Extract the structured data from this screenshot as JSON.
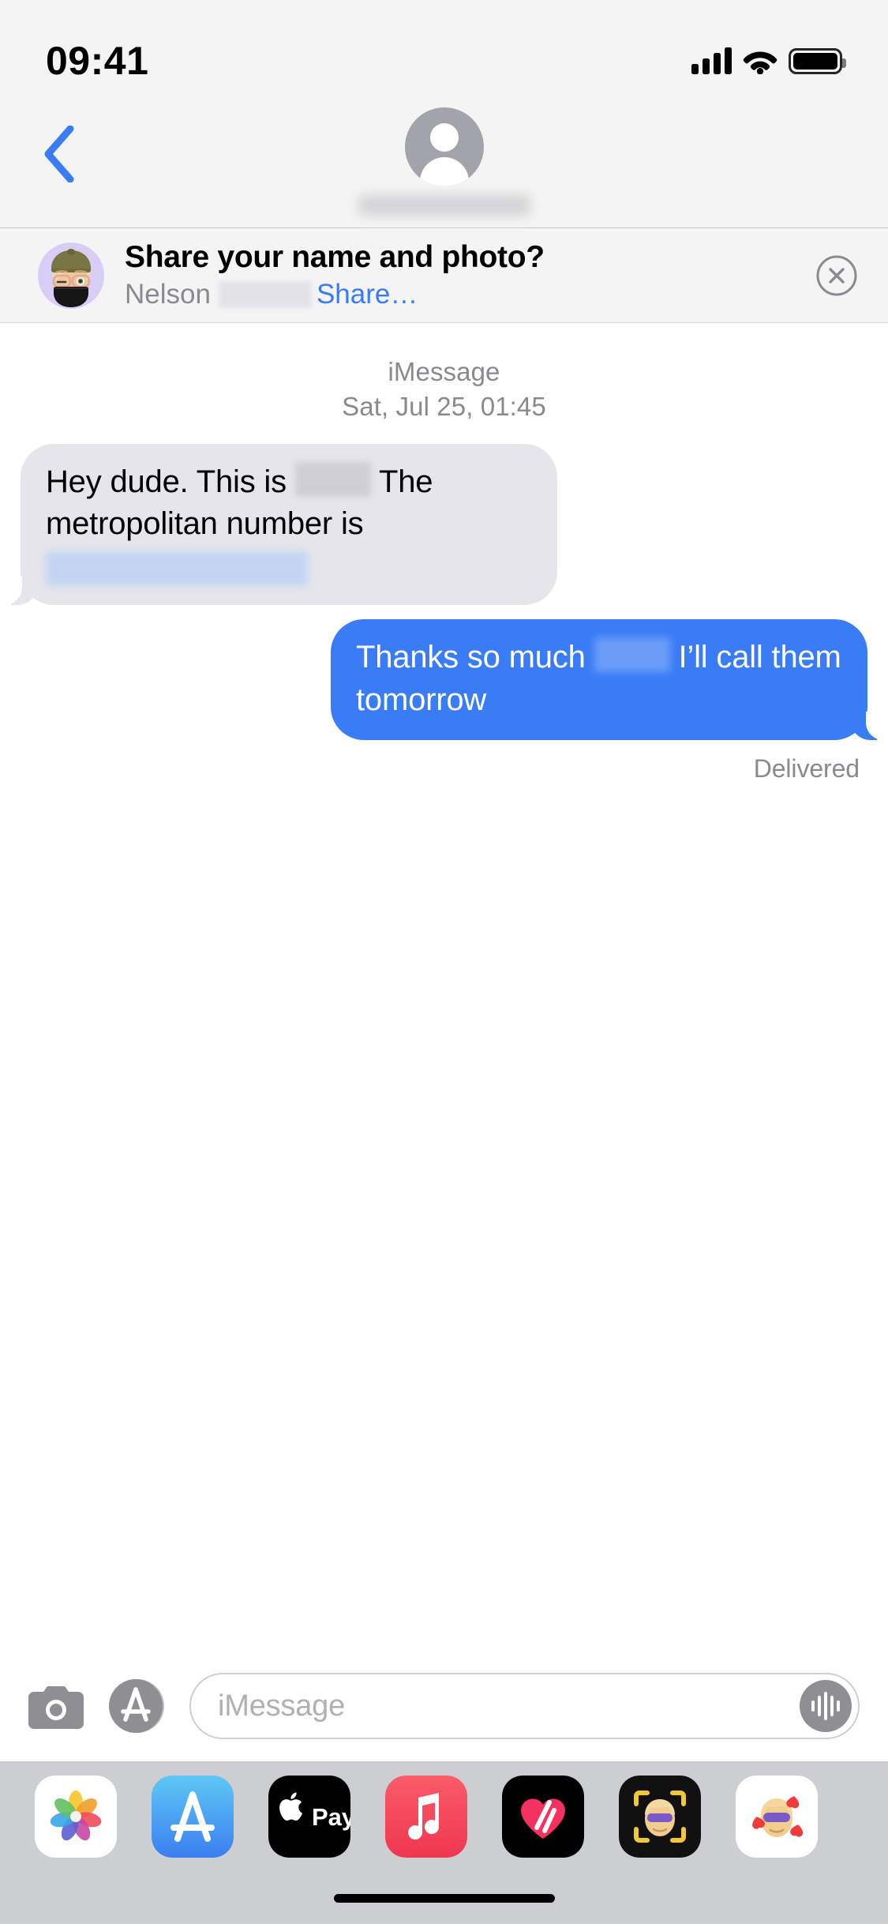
{
  "status_bar": {
    "time": "09:41",
    "cellular_icon": "cellular-bars-icon",
    "cellular_bars": 4,
    "wifi_icon": "wifi-icon",
    "battery_icon": "battery-full-icon",
    "battery_level": 100
  },
  "nav_bar": {
    "back_icon": "chevron-left-icon",
    "back_label": "",
    "avatar_icon": "contact-avatar-placeholder-icon",
    "contact_name": "",
    "contact_name_redacted": true
  },
  "share_banner": {
    "avatar_icon": "memoji-avatar-icon",
    "title": "Share your name and photo?",
    "sub_name": "Nelson",
    "sub_name_redacted": true,
    "share_link": "Share…",
    "close_icon": "close-circle-icon",
    "accent_color": "#3a7cf6"
  },
  "conversation": {
    "service_label": "iMessage",
    "timestamp": "Sat, Jul 25, 01:45",
    "messages": [
      {
        "id": "msg-1",
        "direction": "incoming",
        "bubble_color": "#e6e5eb",
        "text_color": "#000000",
        "text_before_redaction": "Hey dude. This is",
        "text_after_redaction": "The metropolitan number is",
        "has_inline_redaction": true,
        "has_link_redaction": true
      },
      {
        "id": "msg-2",
        "direction": "outgoing",
        "bubble_color": "#3a7cf6",
        "text_color": "#ffffff",
        "text_before_redaction": "Thanks so much",
        "text_after_redaction": "I’ll call them tomorrow",
        "has_inline_redaction": true,
        "has_link_redaction": false
      }
    ],
    "delivery_status": "Delivered"
  },
  "input_bar": {
    "camera_icon": "camera-icon",
    "appstore_icon": "app-store-icon",
    "placeholder": "iMessage",
    "value": "",
    "audio_icon": "audio-waveform-icon"
  },
  "app_drawer": {
    "apps": [
      {
        "id": "photos",
        "icon": "photos-app-icon",
        "label": "Photos"
      },
      {
        "id": "app-store",
        "icon": "app-store-app-icon",
        "label": "App Store"
      },
      {
        "id": "apple-pay",
        "icon": "apple-pay-app-icon",
        "label": "Apple Pay"
      },
      {
        "id": "music",
        "icon": "apple-music-app-icon",
        "label": "Music"
      },
      {
        "id": "digital-touch",
        "icon": "digital-touch-app-icon",
        "label": "Digital Touch"
      },
      {
        "id": "memoji",
        "icon": "memoji-app-icon",
        "label": "Memoji"
      },
      {
        "id": "memoji-sticker",
        "icon": "memoji-sticker-icon",
        "label": "Memoji Stickers"
      }
    ]
  },
  "home_indicator": {
    "icon": "home-indicator-bar"
  },
  "colors": {
    "chrome_background": "#f5f4f5",
    "conversation_background": "#ffffff",
    "incoming_bubble": "#e6e5eb",
    "outgoing_bubble": "#3a7cf6",
    "accent_blue": "#3a7cf6",
    "secondary_text": "#8a8a8e",
    "drawer_background": "#cdced2"
  }
}
